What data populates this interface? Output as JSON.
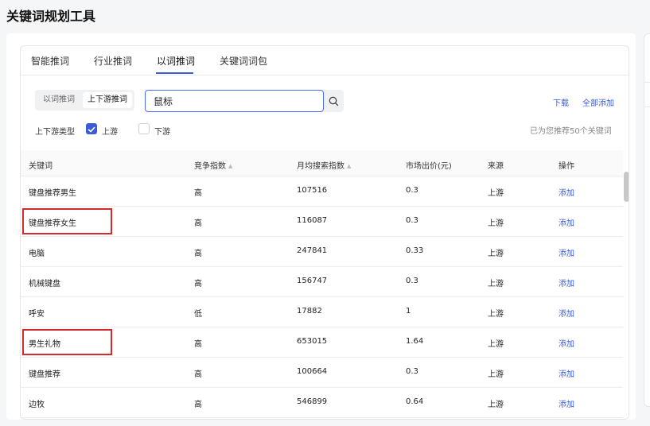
{
  "page_title": "关键词规划工具",
  "tabs": [
    "智能推词",
    "行业推词",
    "以词推词",
    "关键词词包"
  ],
  "segment": [
    "以词推词",
    "上下游推词"
  ],
  "search": {
    "value": "鼠标",
    "placeholder": ""
  },
  "actions": {
    "download": "下载",
    "add_all": "全部添加"
  },
  "filter": {
    "label": "上下游类型",
    "upstream": "上游",
    "downstream": "下游",
    "upstream_checked": true,
    "downstream_checked": false
  },
  "recommend_count": "已为您推荐50个关键词",
  "accent_color": "#3b5bdb",
  "highlight_color": "#d62b2b",
  "table": {
    "headers": [
      "关键词",
      "竞争指数",
      "月均搜索指数",
      "市场出价(元)",
      "来源",
      "操作"
    ],
    "sortable": [
      false,
      true,
      true,
      false,
      false,
      false
    ],
    "rows": [
      [
        "键盘推荐男生",
        "高",
        "107516",
        "0.3",
        "上游",
        "添加"
      ],
      [
        "键盘推荐女生",
        "高",
        "116087",
        "0.3",
        "上游",
        "添加"
      ],
      [
        "电脑",
        "高",
        "247841",
        "0.33",
        "上游",
        "添加"
      ],
      [
        "机械键盘",
        "高",
        "156747",
        "0.3",
        "上游",
        "添加"
      ],
      [
        "呼安",
        "低",
        "17882",
        "1",
        "上游",
        "添加"
      ],
      [
        "男生礼物",
        "高",
        "653015",
        "1.64",
        "上游",
        "添加"
      ],
      [
        "键盘推荐",
        "高",
        "100664",
        "0.3",
        "上游",
        "添加"
      ],
      [
        "边牧",
        "高",
        "546899",
        "0.64",
        "上游",
        "添加"
      ]
    ],
    "highlighted_rows": [
      1,
      5
    ]
  },
  "icons": {
    "search": "search-icon",
    "sort": "sort-icon",
    "check": "check-icon"
  }
}
